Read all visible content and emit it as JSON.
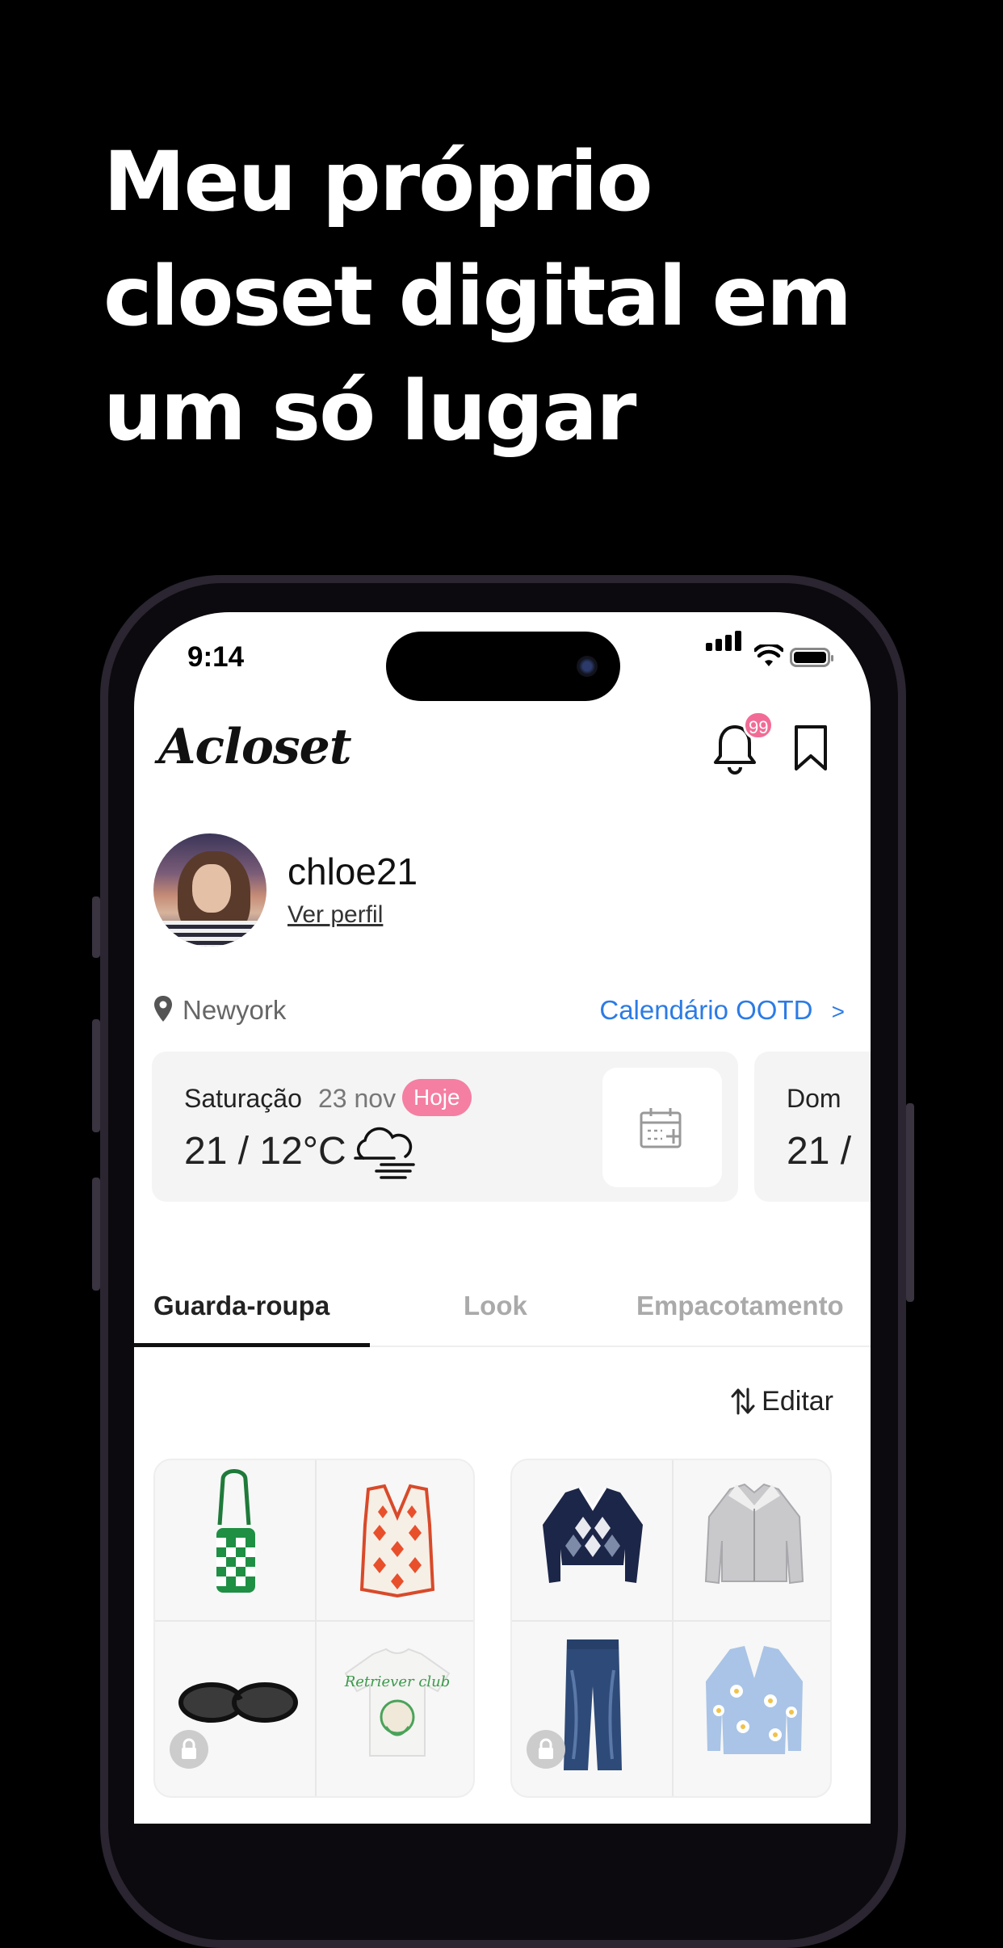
{
  "headline": {
    "line1": "Meu próprio",
    "line2": "closet digital em",
    "line3": "um só lugar"
  },
  "status_bar": {
    "time": "9:14"
  },
  "app": {
    "logo": "Acloset",
    "notification_badge": "99",
    "icons": [
      "bell-icon",
      "bookmark-icon"
    ]
  },
  "profile": {
    "username": "chloe21",
    "view_profile": "Ver perfil"
  },
  "location": {
    "city": "Newyork",
    "calendar_link": "Calendário OOTD",
    "calendar_chevron": ">"
  },
  "weather": [
    {
      "day": "Saturação",
      "date": "23 nov",
      "tag": "Hoje",
      "temp": "21 / 12°C",
      "icon": "fog-cloud-icon"
    },
    {
      "day": "Dom",
      "temp": "21 /"
    }
  ],
  "tabs": [
    "Guarda-roupa",
    "Look",
    "Empacotamento"
  ],
  "active_tab": "Guarda-roupa",
  "edit_label": "Editar",
  "closet_items": [
    [
      "green-checker-bag",
      "red-argyle-vest",
      "black-sunglasses",
      "white-graphic-tee"
    ],
    [
      "navy-argyle-sweater",
      "grey-shearling-jacket",
      "blue-jeans",
      "blue-daisy-cardigan"
    ]
  ],
  "graphic_tee_text": "Retriever club",
  "colors": {
    "accent_blue": "#2c7be5",
    "badge_pink": "#f26b96",
    "tag_pink": "#f47fa2"
  }
}
